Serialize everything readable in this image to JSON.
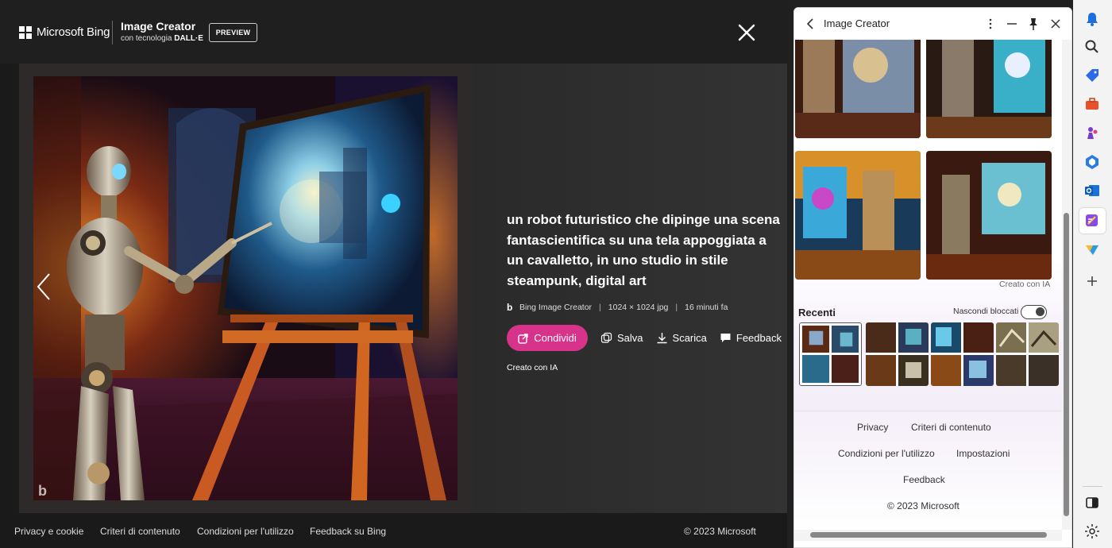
{
  "viewer": {
    "brand": "Microsoft Bing",
    "product_title": "Image Creator",
    "product_sub_prefix": "con tecnologia",
    "product_sub_bold": "DALL·E",
    "preview_badge": "PREVIEW",
    "prompt": "un robot futuristico che dipinge una scena fantascientifica su una tela appoggiata a un cavalletto, in uno studio in stile steampunk, digital art",
    "meta": {
      "source": "Bing Image Creator",
      "size": "1024 × 1024 jpg",
      "time": "16 minuti fa"
    },
    "actions": {
      "share": "Condividi",
      "save": "Salva",
      "download": "Scarica",
      "feedback": "Feedback"
    },
    "created_label": "Creato con IA",
    "footer": {
      "privacy": "Privacy e cookie",
      "content": "Criteri di contenuto",
      "terms": "Condizioni per l'utilizzo",
      "feedback": "Feedback su Bing",
      "copyright": "© 2023 Microsoft"
    }
  },
  "panel": {
    "title": "Image Creator",
    "created_label": "Creato con IA",
    "recent_heading": "Recenti",
    "hide_blocked": "Nascondi bloccati",
    "hide_blocked_on": true,
    "links": {
      "privacy": "Privacy",
      "content": "Criteri di contenuto",
      "terms": "Condizioni per l'utilizzo",
      "settings": "Impostazioni",
      "feedback": "Feedback",
      "copyright": "© 2023 Microsoft"
    }
  },
  "rail_icons": [
    "bell-icon",
    "search-icon",
    "tag-icon",
    "toolbox-icon",
    "chess-icon",
    "office-icon",
    "outlook-icon",
    "image-creator-icon",
    "drop-icon",
    "add-icon",
    "sidebar-toggle-icon",
    "gear-icon"
  ],
  "colors": {
    "share_button": "#d7338a",
    "viewer_bg": "#262626",
    "panel_bg": "#ffffff"
  }
}
